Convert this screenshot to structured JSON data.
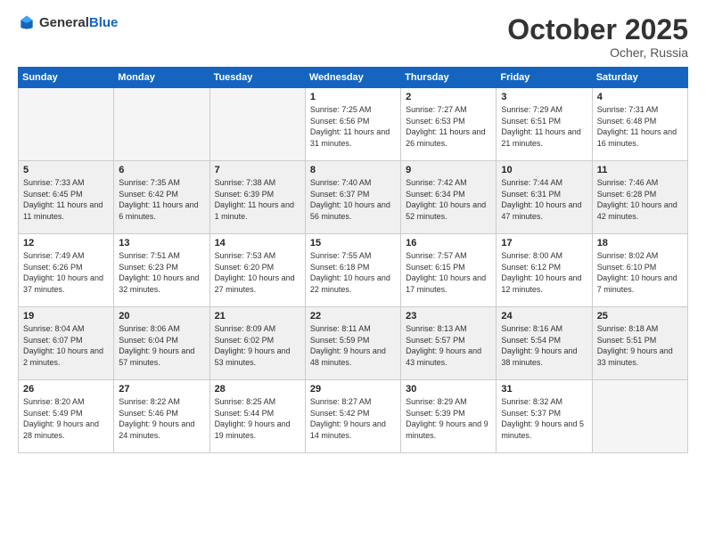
{
  "header": {
    "logo_general": "General",
    "logo_blue": "Blue",
    "month": "October 2025",
    "location": "Ocher, Russia"
  },
  "weekdays": [
    "Sunday",
    "Monday",
    "Tuesday",
    "Wednesday",
    "Thursday",
    "Friday",
    "Saturday"
  ],
  "weeks": [
    [
      {
        "day": "",
        "info": ""
      },
      {
        "day": "",
        "info": ""
      },
      {
        "day": "",
        "info": ""
      },
      {
        "day": "1",
        "info": "Sunrise: 7:25 AM\nSunset: 6:56 PM\nDaylight: 11 hours\nand 31 minutes."
      },
      {
        "day": "2",
        "info": "Sunrise: 7:27 AM\nSunset: 6:53 PM\nDaylight: 11 hours\nand 26 minutes."
      },
      {
        "day": "3",
        "info": "Sunrise: 7:29 AM\nSunset: 6:51 PM\nDaylight: 11 hours\nand 21 minutes."
      },
      {
        "day": "4",
        "info": "Sunrise: 7:31 AM\nSunset: 6:48 PM\nDaylight: 11 hours\nand 16 minutes."
      }
    ],
    [
      {
        "day": "5",
        "info": "Sunrise: 7:33 AM\nSunset: 6:45 PM\nDaylight: 11 hours\nand 11 minutes."
      },
      {
        "day": "6",
        "info": "Sunrise: 7:35 AM\nSunset: 6:42 PM\nDaylight: 11 hours\nand 6 minutes."
      },
      {
        "day": "7",
        "info": "Sunrise: 7:38 AM\nSunset: 6:39 PM\nDaylight: 11 hours\nand 1 minute."
      },
      {
        "day": "8",
        "info": "Sunrise: 7:40 AM\nSunset: 6:37 PM\nDaylight: 10 hours\nand 56 minutes."
      },
      {
        "day": "9",
        "info": "Sunrise: 7:42 AM\nSunset: 6:34 PM\nDaylight: 10 hours\nand 52 minutes."
      },
      {
        "day": "10",
        "info": "Sunrise: 7:44 AM\nSunset: 6:31 PM\nDaylight: 10 hours\nand 47 minutes."
      },
      {
        "day": "11",
        "info": "Sunrise: 7:46 AM\nSunset: 6:28 PM\nDaylight: 10 hours\nand 42 minutes."
      }
    ],
    [
      {
        "day": "12",
        "info": "Sunrise: 7:49 AM\nSunset: 6:26 PM\nDaylight: 10 hours\nand 37 minutes."
      },
      {
        "day": "13",
        "info": "Sunrise: 7:51 AM\nSunset: 6:23 PM\nDaylight: 10 hours\nand 32 minutes."
      },
      {
        "day": "14",
        "info": "Sunrise: 7:53 AM\nSunset: 6:20 PM\nDaylight: 10 hours\nand 27 minutes."
      },
      {
        "day": "15",
        "info": "Sunrise: 7:55 AM\nSunset: 6:18 PM\nDaylight: 10 hours\nand 22 minutes."
      },
      {
        "day": "16",
        "info": "Sunrise: 7:57 AM\nSunset: 6:15 PM\nDaylight: 10 hours\nand 17 minutes."
      },
      {
        "day": "17",
        "info": "Sunrise: 8:00 AM\nSunset: 6:12 PM\nDaylight: 10 hours\nand 12 minutes."
      },
      {
        "day": "18",
        "info": "Sunrise: 8:02 AM\nSunset: 6:10 PM\nDaylight: 10 hours\nand 7 minutes."
      }
    ],
    [
      {
        "day": "19",
        "info": "Sunrise: 8:04 AM\nSunset: 6:07 PM\nDaylight: 10 hours\nand 2 minutes."
      },
      {
        "day": "20",
        "info": "Sunrise: 8:06 AM\nSunset: 6:04 PM\nDaylight: 9 hours\nand 57 minutes."
      },
      {
        "day": "21",
        "info": "Sunrise: 8:09 AM\nSunset: 6:02 PM\nDaylight: 9 hours\nand 53 minutes."
      },
      {
        "day": "22",
        "info": "Sunrise: 8:11 AM\nSunset: 5:59 PM\nDaylight: 9 hours\nand 48 minutes."
      },
      {
        "day": "23",
        "info": "Sunrise: 8:13 AM\nSunset: 5:57 PM\nDaylight: 9 hours\nand 43 minutes."
      },
      {
        "day": "24",
        "info": "Sunrise: 8:16 AM\nSunset: 5:54 PM\nDaylight: 9 hours\nand 38 minutes."
      },
      {
        "day": "25",
        "info": "Sunrise: 8:18 AM\nSunset: 5:51 PM\nDaylight: 9 hours\nand 33 minutes."
      }
    ],
    [
      {
        "day": "26",
        "info": "Sunrise: 8:20 AM\nSunset: 5:49 PM\nDaylight: 9 hours\nand 28 minutes."
      },
      {
        "day": "27",
        "info": "Sunrise: 8:22 AM\nSunset: 5:46 PM\nDaylight: 9 hours\nand 24 minutes."
      },
      {
        "day": "28",
        "info": "Sunrise: 8:25 AM\nSunset: 5:44 PM\nDaylight: 9 hours\nand 19 minutes."
      },
      {
        "day": "29",
        "info": "Sunrise: 8:27 AM\nSunset: 5:42 PM\nDaylight: 9 hours\nand 14 minutes."
      },
      {
        "day": "30",
        "info": "Sunrise: 8:29 AM\nSunset: 5:39 PM\nDaylight: 9 hours\nand 9 minutes."
      },
      {
        "day": "31",
        "info": "Sunrise: 8:32 AM\nSunset: 5:37 PM\nDaylight: 9 hours\nand 5 minutes."
      },
      {
        "day": "",
        "info": ""
      }
    ]
  ]
}
